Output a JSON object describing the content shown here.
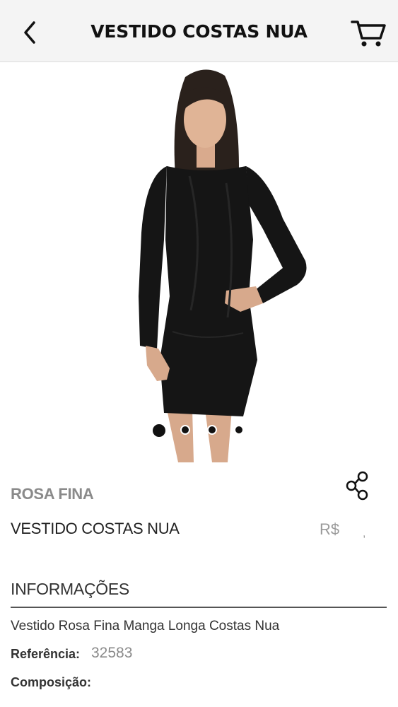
{
  "header": {
    "title": "VESTIDO COSTAS NUA"
  },
  "gallery": {
    "image_count": 4,
    "active_index": 0
  },
  "product": {
    "brand": "ROSA FINA",
    "name": "VESTIDO COSTAS NUA",
    "price_currency": "R$",
    "price_separator": ","
  },
  "info": {
    "heading": "INFORMAÇÕES",
    "description": "Vestido Rosa Fina Manga Longa Costas Nua",
    "reference_label": "Referência:",
    "reference_value": "32583",
    "composition_label": "Composição:"
  },
  "icons": {
    "back": "chevron-left-icon",
    "cart": "cart-icon",
    "share": "share-icon"
  },
  "colors": {
    "header_bg": "#f4f4f4",
    "text_dark": "#222222",
    "text_muted": "#8a8a8a",
    "dress": "#111111"
  }
}
